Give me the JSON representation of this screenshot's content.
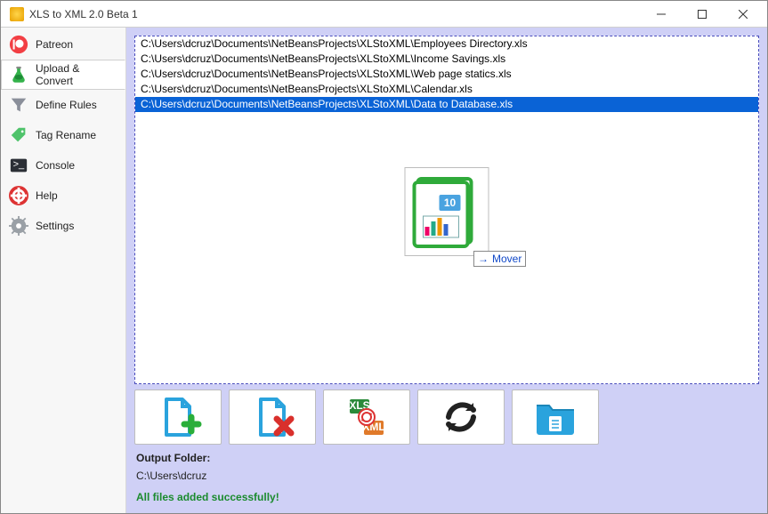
{
  "window": {
    "title": "XLS to XML 2.0 Beta 1"
  },
  "sidebar": {
    "items": [
      {
        "label": "Patreon",
        "icon": "patreon-icon"
      },
      {
        "label": "Upload & Convert",
        "icon": "flask-icon"
      },
      {
        "label": "Define Rules",
        "icon": "funnel-icon"
      },
      {
        "label": "Tag Rename",
        "icon": "tag-icon"
      },
      {
        "label": "Console",
        "icon": "terminal-icon"
      },
      {
        "label": "Help",
        "icon": "lifebuoy-icon"
      },
      {
        "label": "Settings",
        "icon": "gear-icon"
      }
    ]
  },
  "files": [
    "C:\\Users\\dcruz\\Documents\\NetBeansProjects\\XLStoXML\\Employees Directory.xls",
    "C:\\Users\\dcruz\\Documents\\NetBeansProjects\\XLStoXML\\Income Savings.xls",
    "C:\\Users\\dcruz\\Documents\\NetBeansProjects\\XLStoXML\\Web page statics.xls",
    "C:\\Users\\dcruz\\Documents\\NetBeansProjects\\XLStoXML\\Calendar.xls",
    "C:\\Users\\dcruz\\Documents\\NetBeansProjects\\XLStoXML\\Data to Database.xls"
  ],
  "selected_index": 4,
  "drag_tooltip": "Mover",
  "output": {
    "label": "Output Folder:",
    "path": "C:\\Users\\dcruz"
  },
  "status_message": "All files added successfully!",
  "toolbar": {
    "add": "add-file-button",
    "remove": "remove-file-button",
    "convert": "convert-button",
    "refresh": "refresh-button",
    "open_folder": "open-folder-button"
  },
  "colors": {
    "accent": "#cfd0f6",
    "selection": "#0a63d6",
    "success": "#1b8b2e"
  }
}
